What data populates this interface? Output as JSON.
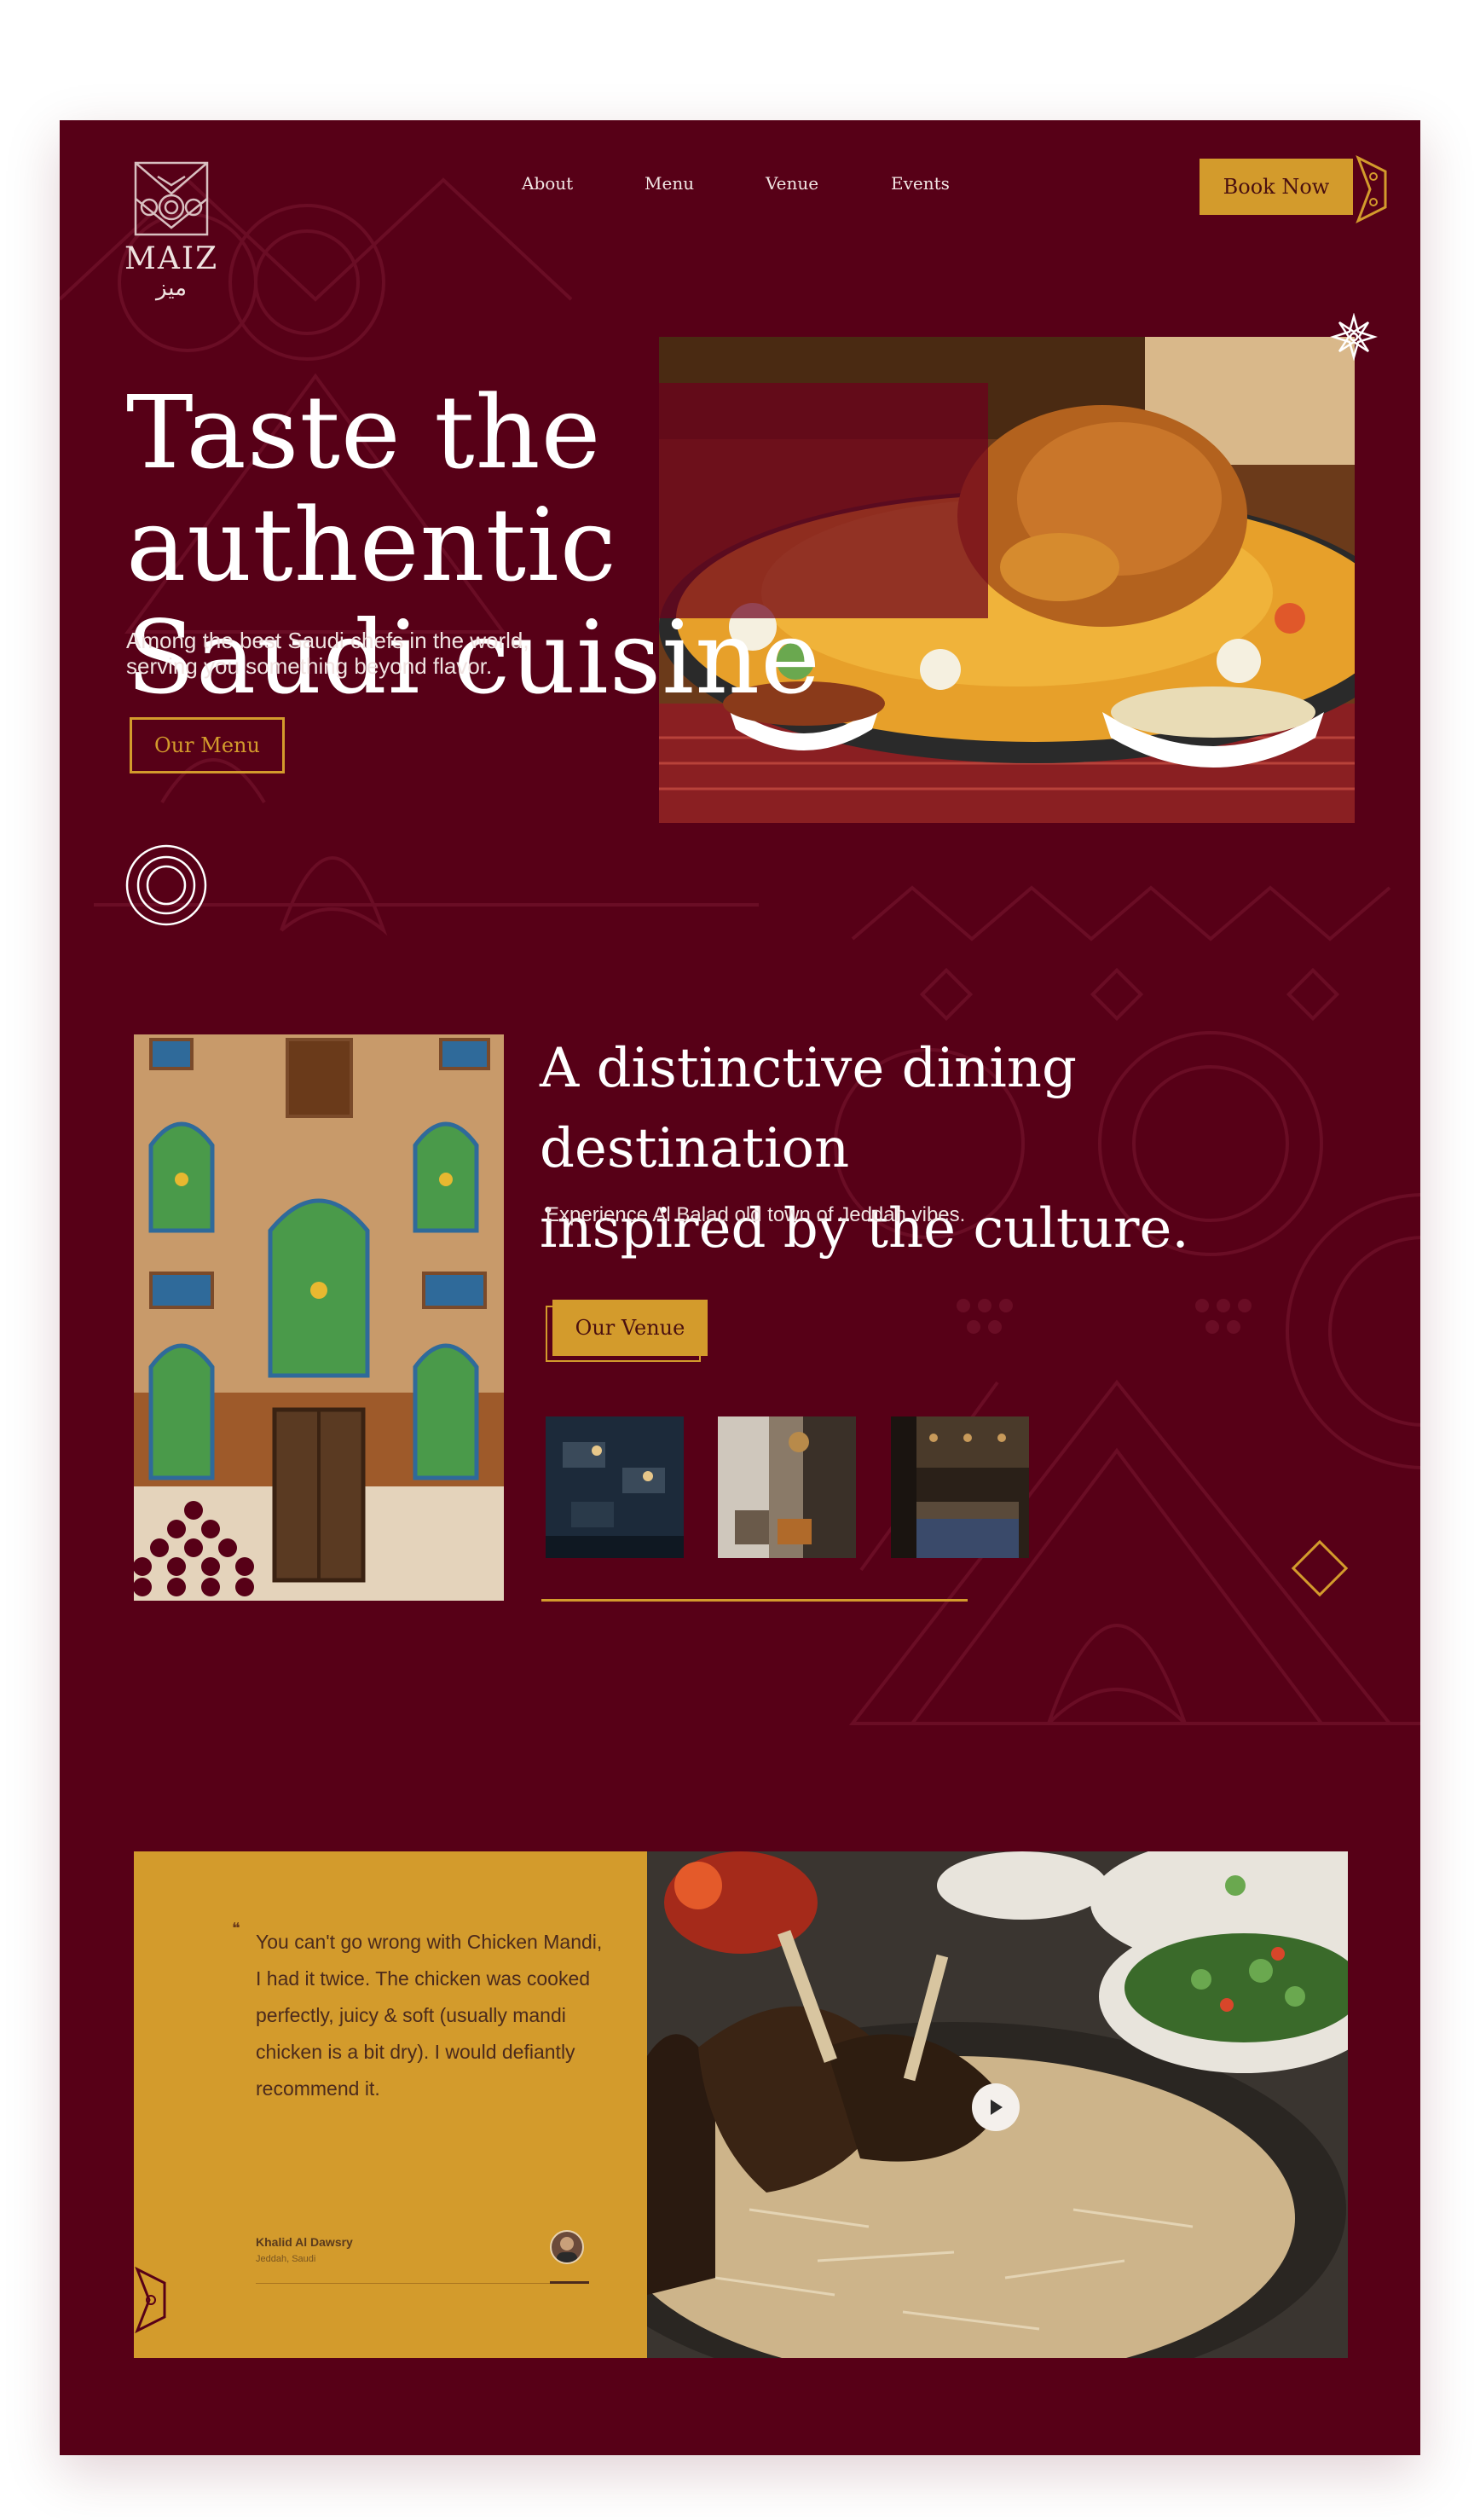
{
  "brand": {
    "name": "MAIZ",
    "arabic": "ميز"
  },
  "nav": {
    "items": [
      "About",
      "Menu",
      "Venue",
      "Events"
    ],
    "book_label": "Book Now"
  },
  "hero": {
    "title_line1": "Taste the authentic",
    "title_line2": "Saudi cuisine",
    "subtitle_line1": "Among the best Saudi chefs in the world,",
    "subtitle_line2": "serving you something beyond flavor.",
    "cta": "Our Menu"
  },
  "venue": {
    "title_line1": "A distinctive dining destination",
    "title_line2": "inspired by the culture.",
    "subtitle": "Experience Al Balad old town of Jeddah vibes.",
    "cta": "Our Venue"
  },
  "testimonial": {
    "quote_mark": "❝",
    "quote": "You can't go wrong with Chicken Mandi, I had it twice. The chicken was cooked perfectly, juicy & soft (usually mandi chicken is a bit dry). I would defiantly recommend it.",
    "name": "Khalid Al Dawsry",
    "location": "Jeddah, Saudi"
  },
  "colors": {
    "background": "#570017",
    "gold": "#d39b2c",
    "text_light": "#ffffff"
  }
}
